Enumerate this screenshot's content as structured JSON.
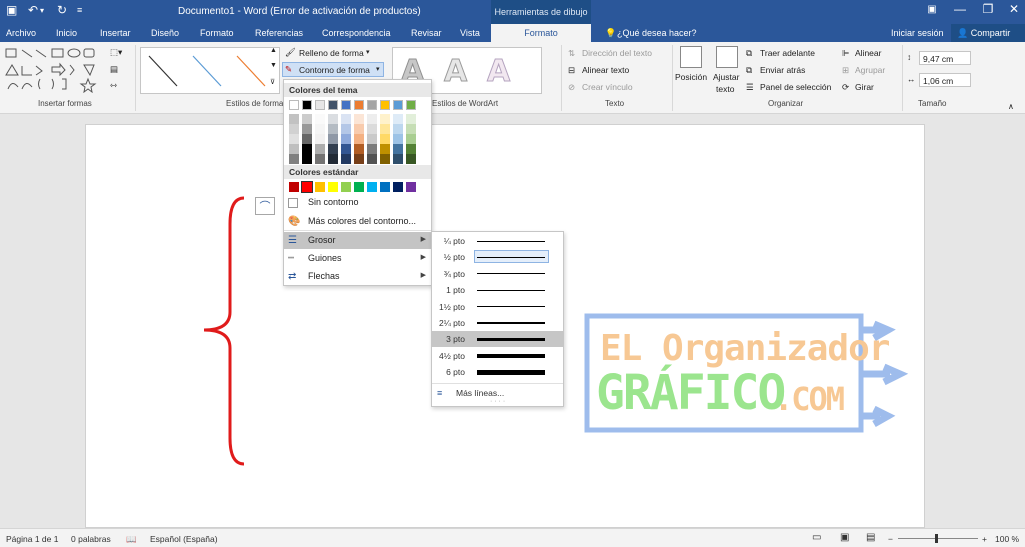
{
  "titlebar": {
    "document_title": "Documento1 - Word (Error de activación de productos)",
    "context_tools": "Herramientas de dibujo",
    "minimize": "—",
    "maximize": "❐",
    "close": "✕"
  },
  "tabs": {
    "items": [
      "Archivo",
      "Inicio",
      "Insertar",
      "Diseño",
      "Formato",
      "Referencias",
      "Correspondencia",
      "Revisar",
      "Vista"
    ],
    "active": "Formato",
    "tell_me": "¿Qué desea hacer?",
    "sign_in": "Iniciar sesión",
    "share": "Compartir"
  },
  "ribbon": {
    "groups": {
      "insert_shapes": "Insertar formas",
      "shape_styles": "Estilos de forma",
      "wordart_styles": "Estilos de WordArt",
      "text": "Texto",
      "arrange": "Organizar",
      "size": "Tamaño"
    },
    "shape_fill": "Relleno de forma",
    "shape_outline": "Contorno de forma",
    "text_direction": "Dirección del texto",
    "align_text": "Alinear texto",
    "create_link": "Crear vínculo",
    "position": "Posición",
    "wrap_text_1": "Ajustar",
    "wrap_text_2": "texto",
    "bring_forward": "Traer adelante",
    "send_backward": "Enviar atrás",
    "selection_pane": "Panel de selección",
    "align": "Alinear",
    "group": "Agrupar",
    "rotate": "Girar",
    "height": "9,47 cm",
    "width": "1,06 cm",
    "wordart_letter": "A"
  },
  "color_menu": {
    "theme_colors_label": "Colores del tema",
    "standard_colors_label": "Colores estándar",
    "no_outline": "Sin contorno",
    "more_colors": "Más colores del contorno...",
    "weight": "Grosor",
    "dashes": "Guiones",
    "arrows": "Flechas",
    "theme_colors": [
      "#ffffff",
      "#000000",
      "#e7e6e6",
      "#44546a",
      "#4472c4",
      "#ed7d31",
      "#a5a5a5",
      "#ffc000",
      "#5b9bd5",
      "#70ad47"
    ],
    "standard_colors": [
      "#c00000",
      "#ff0000",
      "#ffc000",
      "#ffff00",
      "#92d050",
      "#00b050",
      "#00b0f0",
      "#0070c0",
      "#002060",
      "#7030a0"
    ]
  },
  "weight_menu": {
    "items": [
      {
        "label": "¼ pto",
        "points": 0.25
      },
      {
        "label": "½ pto",
        "points": 0.5
      },
      {
        "label": "¾ pto",
        "points": 0.75
      },
      {
        "label": "1 pto",
        "points": 1
      },
      {
        "label": "1½ pto",
        "points": 1.5
      },
      {
        "label": "2¼ pto",
        "points": 2.25
      },
      {
        "label": "3 pto",
        "points": 3
      },
      {
        "label": "4½ pto",
        "points": 4.5
      },
      {
        "label": "6 pto",
        "points": 6
      }
    ],
    "selected": "3 pto",
    "more_lines": "Más líneas..."
  },
  "watermark": {
    "line1": "EL Organizador",
    "line2": "GRÁFICO",
    "line3": ".COM"
  },
  "status": {
    "page": "Página 1 de 1",
    "words": "0 palabras",
    "language": "Español (España)",
    "zoom": "100 %"
  },
  "colors": {
    "accent": "#2b579a",
    "brace": "#e01b1b",
    "watermark_border": "#9ebcec",
    "watermark_green": "#9be58e",
    "watermark_orange": "#f7c894"
  }
}
